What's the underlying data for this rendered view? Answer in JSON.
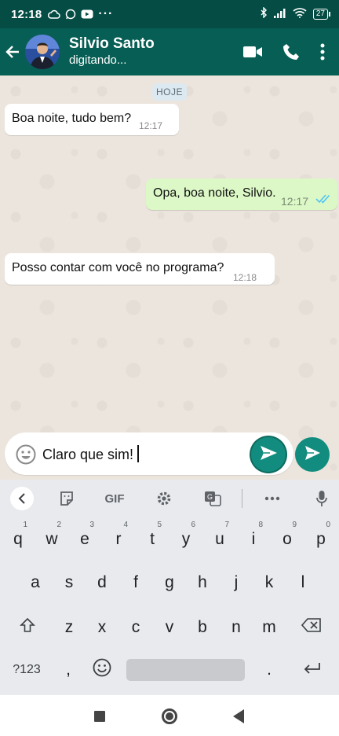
{
  "status_bar": {
    "time": "12:18",
    "battery": "27",
    "icons": [
      "cloud-icon",
      "whatsapp-icon",
      "youtube-icon",
      "more-dots-icon",
      "bluetooth-icon",
      "signal-icon",
      "wifi-icon",
      "battery-icon"
    ]
  },
  "header": {
    "contact_name": "Silvio Santo",
    "status": "digitando...",
    "icons": [
      "back-arrow-icon",
      "video-call-icon",
      "phone-call-icon",
      "more-vert-icon"
    ]
  },
  "chat": {
    "date_chip": "HOJE",
    "messages": [
      {
        "direction": "in",
        "text": "Boa noite, tudo bem?",
        "time": "12:17"
      },
      {
        "direction": "out",
        "text": "Opa, boa noite, Silvio.",
        "time": "12:17",
        "status": "read"
      },
      {
        "direction": "in",
        "text": "Posso contar com você no programa?",
        "time": "12:18"
      }
    ]
  },
  "composer": {
    "value": "Claro que sim!",
    "icons": [
      "emoji-icon",
      "send-icon",
      "send-icon"
    ]
  },
  "keyboard": {
    "toolbar": {
      "gif_label": "GIF",
      "icons": [
        "chevron-left-icon",
        "sticker-icon",
        "gear-icon",
        "translate-icon",
        "more-horiz-icon",
        "mic-icon"
      ]
    },
    "row1": [
      {
        "key": "q",
        "hint": "1"
      },
      {
        "key": "w",
        "hint": "2"
      },
      {
        "key": "e",
        "hint": "3"
      },
      {
        "key": "r",
        "hint": "4"
      },
      {
        "key": "t",
        "hint": "5"
      },
      {
        "key": "y",
        "hint": "6"
      },
      {
        "key": "u",
        "hint": "7"
      },
      {
        "key": "i",
        "hint": "8"
      },
      {
        "key": "o",
        "hint": "9"
      },
      {
        "key": "p",
        "hint": "0"
      }
    ],
    "row2": [
      "a",
      "s",
      "d",
      "f",
      "g",
      "h",
      "j",
      "k",
      "l"
    ],
    "row3": [
      "z",
      "x",
      "c",
      "v",
      "b",
      "n",
      "m"
    ],
    "row4": {
      "symbols": "?123",
      "comma": ",",
      "period": "."
    }
  },
  "colors": {
    "status_bar": "#054d44",
    "header": "#075e54",
    "outgoing_bubble": "#dcf8c6",
    "incoming_bubble": "#ffffff",
    "accent": "#128c7e",
    "read_ticks": "#4fc3f7"
  }
}
